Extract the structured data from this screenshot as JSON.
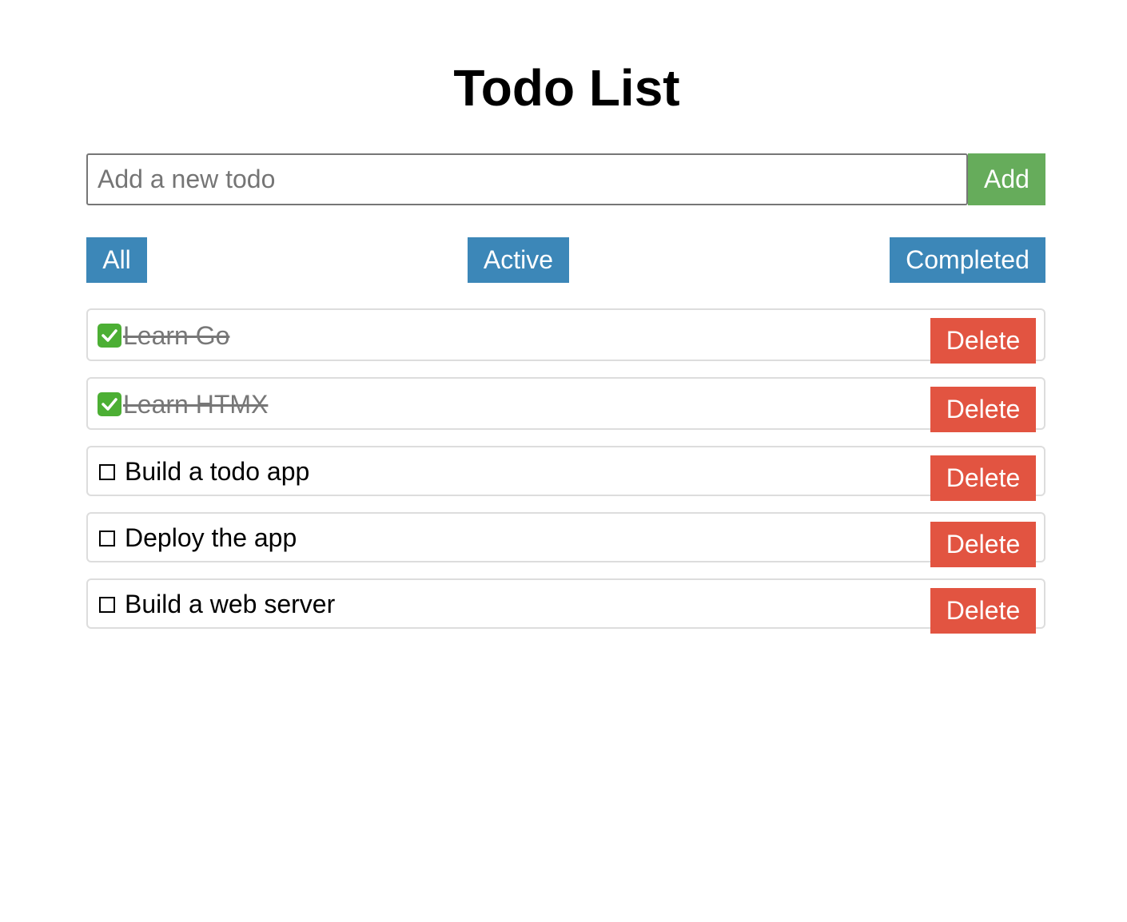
{
  "header": {
    "title": "Todo List"
  },
  "add_form": {
    "placeholder": "Add a new todo",
    "value": "",
    "add_label": "Add"
  },
  "filters": {
    "all": "All",
    "active": "Active",
    "completed": "Completed"
  },
  "todos": [
    {
      "text": "Learn Go",
      "completed": true,
      "delete_label": "Delete"
    },
    {
      "text": "Learn HTMX",
      "completed": true,
      "delete_label": "Delete"
    },
    {
      "text": "Build a todo app",
      "completed": false,
      "delete_label": "Delete"
    },
    {
      "text": "Deploy the app",
      "completed": false,
      "delete_label": "Delete"
    },
    {
      "text": "Build a web server",
      "completed": false,
      "delete_label": "Delete"
    }
  ],
  "colors": {
    "add": "#66ac5b",
    "filter": "#3c87b8",
    "delete": "#e25441",
    "check": "#4caf34"
  },
  "icons": {
    "completed": "check-box-icon",
    "active": "empty-box-icon"
  }
}
